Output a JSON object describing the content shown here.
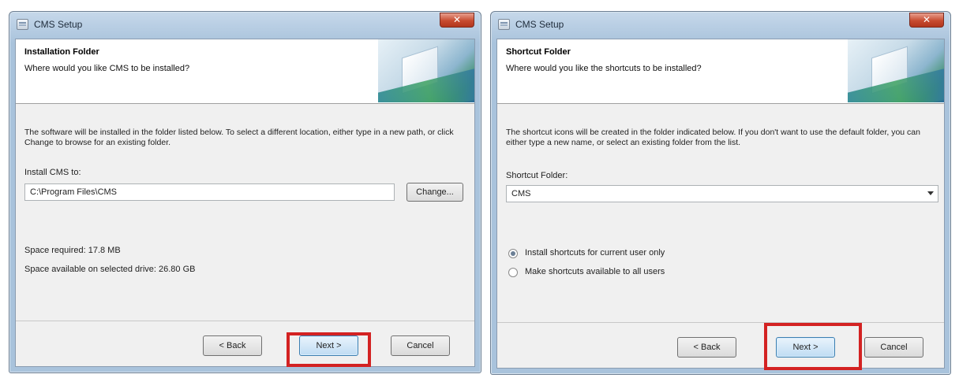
{
  "left_window": {
    "title": "CMS Setup",
    "close_glyph": "✕",
    "header": {
      "title": "Installation Folder",
      "subtitle": "Where would you like CMS to be installed?"
    },
    "description": "The software will be installed in the folder listed below. To select a different location, either type in a new path, or click Change to browse for an existing folder.",
    "install_label": "Install CMS to:",
    "install_path": "C:\\Program Files\\CMS",
    "change_label": "Change...",
    "space_required": "Space required: 17.8 MB",
    "space_available": "Space available on selected drive: 26.80 GB",
    "buttons": {
      "back": "< Back",
      "next": "Next >",
      "cancel": "Cancel"
    }
  },
  "right_window": {
    "title": "CMS Setup",
    "close_glyph": "✕",
    "header": {
      "title": "Shortcut Folder",
      "subtitle": "Where would you like the shortcuts to be installed?"
    },
    "description": "The shortcut icons will be created in the folder indicated below. If you don't want to use the default folder, you can either type a new name, or select an existing folder from the list.",
    "folder_label": "Shortcut Folder:",
    "folder_value": "CMS",
    "options": [
      {
        "label": "Install shortcuts for current user only",
        "selected": true
      },
      {
        "label": "Make shortcuts available to all users",
        "selected": false
      }
    ],
    "buttons": {
      "back": "< Back",
      "next": "Next >",
      "cancel": "Cancel"
    }
  },
  "colors": {
    "highlight": "#d32222",
    "titlebar": "#b4cce3",
    "close_button": "#c74b30"
  },
  "icons": [
    "setup-app-icon",
    "close-icon",
    "wizard-banner-art",
    "dropdown-arrow-icon"
  ]
}
